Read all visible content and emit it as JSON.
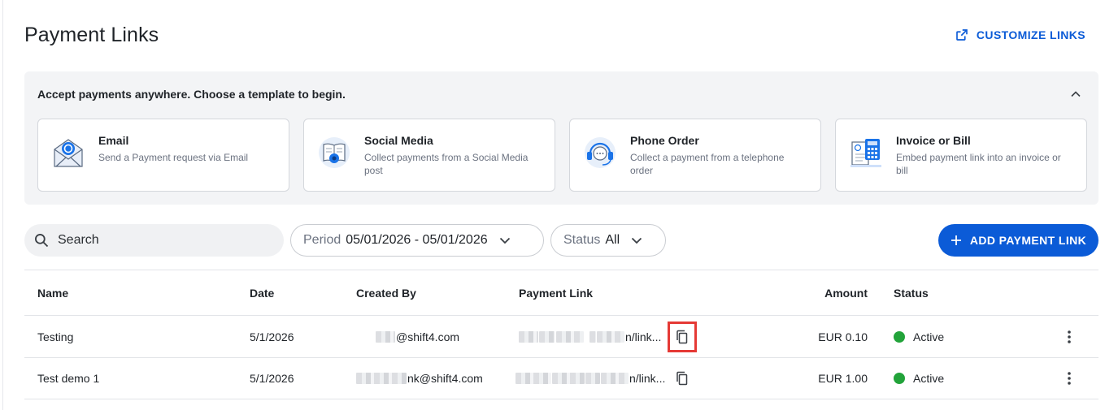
{
  "page": {
    "title": "Payment Links",
    "customize_label": "CUSTOMIZE LINKS"
  },
  "templates": {
    "heading": "Accept payments anywhere. Choose a template to begin.",
    "cards": [
      {
        "title": "Email",
        "description": "Send a Payment request via Email",
        "icon": "email-envelope-icon"
      },
      {
        "title": "Social Media",
        "description": "Collect payments from a Social Media post",
        "icon": "social-media-icon"
      },
      {
        "title": "Phone Order",
        "description": "Collect a payment from a telephone order",
        "icon": "phone-order-icon"
      },
      {
        "title": "Invoice or Bill",
        "description": "Embed payment link into an invoice or bill",
        "icon": "invoice-calculator-icon"
      }
    ]
  },
  "toolbar": {
    "search_placeholder": "Search",
    "period_label": "Period",
    "period_value": "05/01/2026 - 05/01/2026",
    "status_label": "Status",
    "status_value": "All",
    "add_label": "ADD PAYMENT LINK"
  },
  "table": {
    "columns": {
      "name": "Name",
      "date": "Date",
      "created_by": "Created By",
      "payment_link": "Payment Link",
      "amount": "Amount",
      "status": "Status"
    },
    "rows": [
      {
        "name": "Testing",
        "date": "5/1/2026",
        "created_by_suffix": "@shift4.com",
        "link_suffix": "n/link...",
        "amount": "EUR 0.10",
        "status": "Active"
      },
      {
        "name": "Test demo 1",
        "date": "5/1/2026",
        "created_by_suffix": "nk@shift4.com",
        "link_suffix": "n/link...",
        "amount": "EUR 1.00",
        "status": "Active"
      }
    ]
  },
  "colors": {
    "accent": "#0b5bd7",
    "active": "#22a33a",
    "highlight": "#e53935"
  }
}
